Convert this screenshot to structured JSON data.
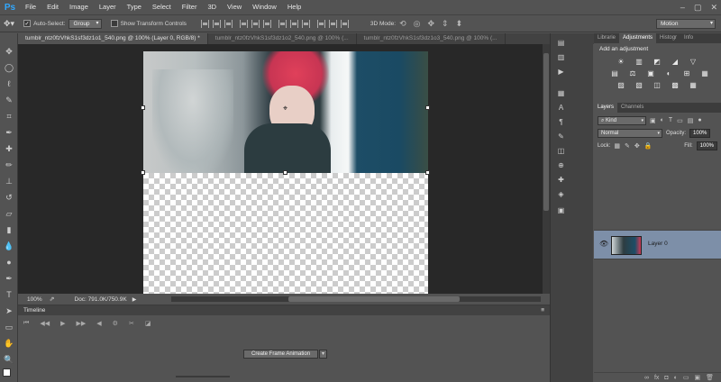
{
  "app": {
    "logo": "Ps"
  },
  "menu": [
    "File",
    "Edit",
    "Image",
    "Layer",
    "Type",
    "Select",
    "Filter",
    "3D",
    "View",
    "Window",
    "Help"
  ],
  "window_controls": [
    "–",
    "▢",
    "✕"
  ],
  "options_bar": {
    "auto_select_label": "Auto-Select:",
    "auto_select_value": "Group",
    "show_transform_label": "Show Transform Controls",
    "mode_3d_label": "3D Mode:",
    "workspace_value": "Motion"
  },
  "tabs": [
    {
      "label": "tumblr_ntz0fzVhkS1sf3dz1o1_540.png @ 100% (Layer 0, RGB/8) *",
      "active": true
    },
    {
      "label": "tumblr_ntz0fzVhkS1sf3dz1o2_540.png @ 100% (...",
      "active": false
    },
    {
      "label": "tumblr_ntz0fzVhkS1sf3dz1o3_540.png @ 100% (...",
      "active": false
    }
  ],
  "statusbar": {
    "zoom": "100%",
    "doc_info": "Doc: 791.0K/750.9K"
  },
  "timeline": {
    "title": "Timeline",
    "create_button": "Create Frame Animation"
  },
  "adjustments": {
    "tabs": [
      "Librarie",
      "Adjustments",
      "Histogr",
      "Info"
    ],
    "active_tab": "Adjustments",
    "title": "Add an adjustment",
    "row1": [
      "☀",
      "▥",
      "◩",
      "◢",
      "▽"
    ],
    "row2": [
      "▤",
      "⚖",
      "▣",
      "◐",
      "⊞",
      "▦"
    ],
    "row3": [
      "▨",
      "▧",
      "◫",
      "▩",
      "▦"
    ]
  },
  "layers": {
    "tabs": [
      "Layers",
      "Channels"
    ],
    "kind_label": "Kind",
    "blend_mode": "Normal",
    "opacity_label": "Opacity:",
    "opacity_value": "100%",
    "lock_label": "Lock:",
    "fill_label": "Fill:",
    "fill_value": "100%",
    "layer_name": "Layer 0",
    "footer_icons": [
      "∞",
      "fx",
      "◘",
      "◐",
      "▭",
      "▣",
      "🗑"
    ]
  },
  "colors": {
    "accent": "#31a8ff",
    "selected_layer": "#7d8fa8"
  }
}
